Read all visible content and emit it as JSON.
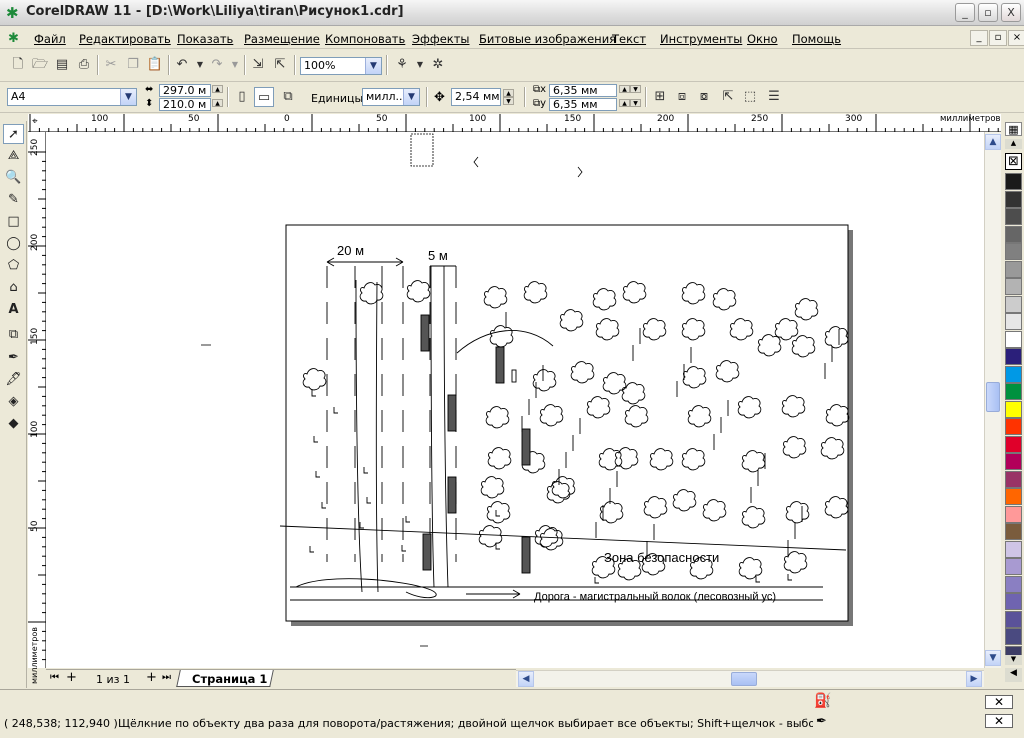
{
  "window": {
    "app_icon": "corel-balloon-icon",
    "title": "CorelDRAW 11 - [D:\\Work\\Liliya\\tiran\\Рисунок1.cdr]",
    "minimize": "_",
    "maximize": "▫",
    "close": "X"
  },
  "menu": {
    "items": [
      "Файл",
      "Редактировать",
      "Показать",
      "Размещение",
      "Компоновать",
      "Эффекты",
      "Битовые изображения",
      "Текст",
      "Инструменты",
      "Окно",
      "Помощь"
    ]
  },
  "standard_toolbar": {
    "zoom_value": "100%"
  },
  "property_bar": {
    "paper_size": "A4",
    "width": "297.0 м",
    "height": "210.0 м",
    "units_label": "Единицы:",
    "units_value": "милл...",
    "nudge": "2,54 мм",
    "dup_x": "6,35 мм",
    "dup_y": "6,35 мм"
  },
  "ruler": {
    "h_labels": [
      "100",
      "50",
      "0",
      "50",
      "100",
      "150",
      "200",
      "250",
      "300"
    ],
    "h_unit": "миллиметров",
    "v_labels": [
      "250",
      "200",
      "150",
      "100",
      "50"
    ],
    "v_unit": "миллиметров"
  },
  "drawing": {
    "label_20m": "20 м",
    "label_5m": "5 м",
    "zone_label": "Зона безопасности",
    "road_label": "Дорога - магистральный волок (лесовозный ус)"
  },
  "page_tabs": {
    "page_count": "1 из 1",
    "current_tab": "Страница 1"
  },
  "status": {
    "coordinates": "( 248,538; 112,940 )",
    "message": "Щёлкние по объекту два раза для поворота/растяжения; двойной щелчок выбирает все объекты; Shift+щелчок - выбор нескольких; A..."
  },
  "palette": {
    "colors": [
      "#1a1a1a",
      "#333333",
      "#4d4d4d",
      "#666666",
      "#808080",
      "#999999",
      "#b3b3b3",
      "#cccccc",
      "#e6e6e6",
      "#ffffff",
      "#2b1f7a",
      "#0099e6",
      "#00913f",
      "#ffff00",
      "#ff3300",
      "#e0002a",
      "#b2005a",
      "#993366",
      "#ff6600",
      "#ff9999",
      "#7a5c3d",
      "#cfc5e6",
      "#a89ad1",
      "#8a7fc2",
      "#6f64b0",
      "#5a5299",
      "#4a4a80",
      "#3d3d66"
    ]
  }
}
